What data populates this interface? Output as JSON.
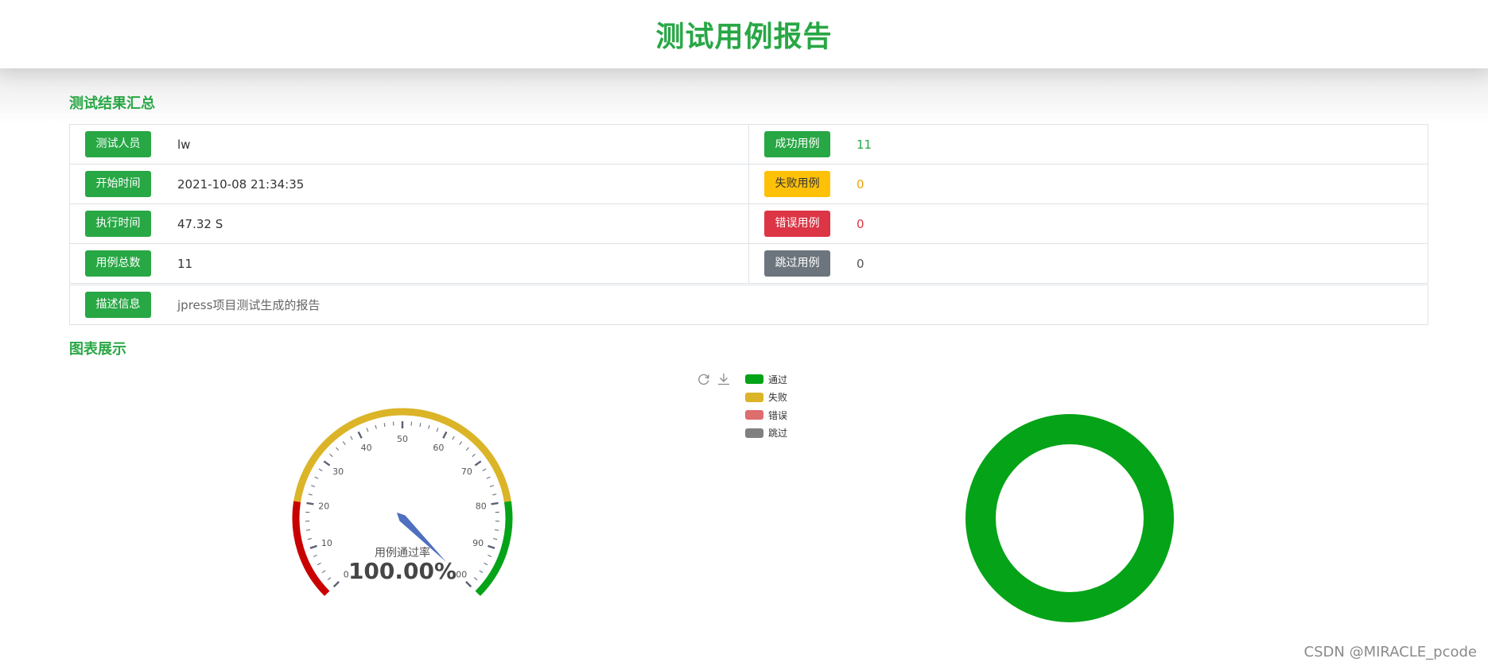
{
  "header": {
    "title": "测试用例报告"
  },
  "summary": {
    "title": "测试结果汇总",
    "left": [
      {
        "label": "测试人员",
        "value": "lw"
      },
      {
        "label": "开始时间",
        "value": "2021-10-08 21:34:35"
      },
      {
        "label": "执行时间",
        "value": "47.32 S"
      },
      {
        "label": "用例总数",
        "value": "11"
      }
    ],
    "right": [
      {
        "label": "成功用例",
        "value": "11"
      },
      {
        "label": "失败用例",
        "value": "0"
      },
      {
        "label": "错误用例",
        "value": "0"
      },
      {
        "label": "跳过用例",
        "value": "0"
      }
    ],
    "description": {
      "label": "描述信息",
      "value": "jpress项目测试生成的报告"
    }
  },
  "charts": {
    "title": "图表展示",
    "gauge": {
      "name": "用例通过率",
      "value_text": "100.00%",
      "value": 100,
      "ticks": [
        "0",
        "10",
        "20",
        "30",
        "40",
        "50",
        "60",
        "70",
        "80",
        "90",
        "100"
      ]
    },
    "legend": [
      {
        "label": "通过",
        "color": "#05a318"
      },
      {
        "label": "失败",
        "color": "#dbb428"
      },
      {
        "label": "错误",
        "color": "#de6d6d"
      },
      {
        "label": "跳过",
        "color": "#808080"
      }
    ],
    "toolbox": [
      "refresh-icon",
      "download-icon"
    ]
  },
  "chart_data": [
    {
      "type": "gauge",
      "title": "用例通过率",
      "value": 100,
      "range": [
        0,
        100
      ],
      "bands": [
        {
          "to": 20,
          "color": "#c80000"
        },
        {
          "to": 80,
          "color": "#dbb428"
        },
        {
          "to": 100,
          "color": "#05a318"
        }
      ]
    },
    {
      "type": "pie",
      "categories": [
        "通过",
        "失败",
        "错误",
        "跳过"
      ],
      "values": [
        11,
        0,
        0,
        0
      ]
    }
  ],
  "watermark": "CSDN @MIRACLE_pcode"
}
